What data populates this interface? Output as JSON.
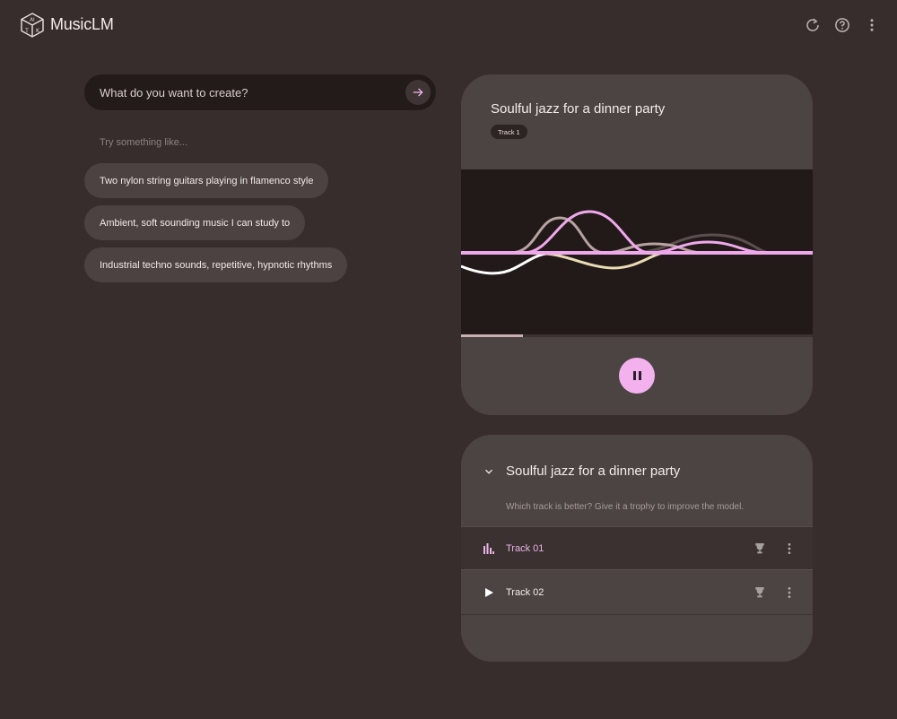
{
  "app": {
    "title": "MusicLM",
    "logo_icon": "cube-logo-icon"
  },
  "header_actions": [
    {
      "name": "reset",
      "icon": "refresh-icon"
    },
    {
      "name": "help",
      "icon": "help-circle-icon"
    },
    {
      "name": "more",
      "icon": "more-vert-icon"
    }
  ],
  "prompt": {
    "placeholder": "What do you want to create?",
    "value": "",
    "submit_icon": "arrow-right-icon"
  },
  "suggestions": {
    "label": "Try something like...",
    "items": [
      "Two nylon string guitars playing in flamenco style",
      "Ambient, soft sounding music I can study to",
      "Industrial techno sounds, repetitive, hypnotic rhythms"
    ]
  },
  "player": {
    "title": "Soulful jazz for a dinner party",
    "track_badge": "Track 1",
    "progress": 0.175,
    "state": "playing",
    "control_icon": "pause-icon",
    "colors": {
      "accent": "#f3b2ee",
      "wave_pink": "#f0a8ec",
      "wave_taupe": "#b8a3a0",
      "wave_cream": "#e9dcb5",
      "wave_white": "#ffffff",
      "wave_dark": "#5a4f4e"
    }
  },
  "results": {
    "title": "Soulful jazz for a dinner party",
    "subtitle": "Which track is better? Give it a trophy to improve the model.",
    "tracks": [
      {
        "label": "Track 01",
        "status": "playing",
        "status_icon": "equalizer-icon",
        "trophy_icon": "trophy-icon",
        "more_icon": "more-vert-icon",
        "color": "#e9b5e5"
      },
      {
        "label": "Track 02",
        "status": "paused",
        "status_icon": "play-icon",
        "trophy_icon": "trophy-icon",
        "more_icon": "more-vert-icon",
        "color": "#f4ecea"
      }
    ]
  }
}
